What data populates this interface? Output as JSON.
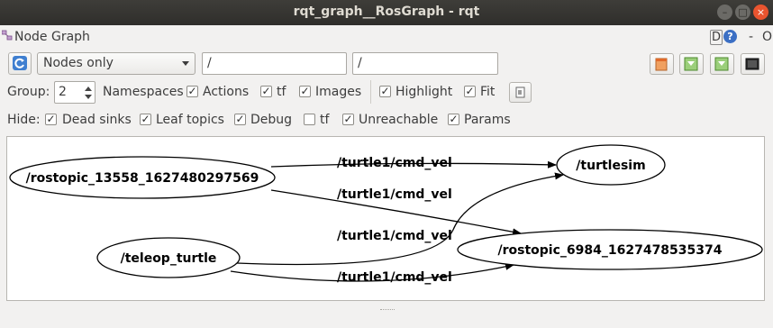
{
  "window": {
    "title": "rqt_graph__RosGraph - rqt"
  },
  "plugin": {
    "title": "Node Graph",
    "d_label": "D",
    "help_label": "?",
    "minimize_label": "-",
    "close_label": "O"
  },
  "toolbar": {
    "refresh_icon": "refresh-icon",
    "mode_select": "Nodes only",
    "filter_node": "/",
    "filter_topic": "/",
    "icons": [
      "open-file-icon",
      "save-dot-icon",
      "save-image-icon",
      "screenshot-icon"
    ]
  },
  "options": {
    "group_label": "Group:",
    "group_value": "2",
    "namespaces": "Namespaces",
    "actions": "Actions",
    "tf": "tf",
    "images": "Images",
    "highlight": "Highlight",
    "fit": "Fit"
  },
  "hide": {
    "label": "Hide:",
    "dead_sinks": "Dead sinks",
    "leaf_topics": "Leaf topics",
    "debug": "Debug",
    "tf": "tf",
    "unreachable": "Unreachable",
    "params": "Params"
  },
  "checkboxes": {
    "actions": true,
    "tf": true,
    "images": true,
    "highlight": true,
    "fit": true,
    "dead_sinks": true,
    "leaf_topics": true,
    "debug": true,
    "hide_tf": false,
    "unreachable": true,
    "params": true
  },
  "graph": {
    "nodes": {
      "rostopic_13558": "/rostopic_13558_1627480297569",
      "turtlesim": "/turtlesim",
      "teleop_turtle": "/teleop_turtle",
      "rostopic_6984": "/rostopic_6984_1627478535374"
    },
    "edges": {
      "e1": "/turtle1/cmd_vel",
      "e2": "/turtle1/cmd_vel",
      "e3": "/turtle1/cmd_vel",
      "e4": "/turtle1/cmd_vel"
    }
  }
}
